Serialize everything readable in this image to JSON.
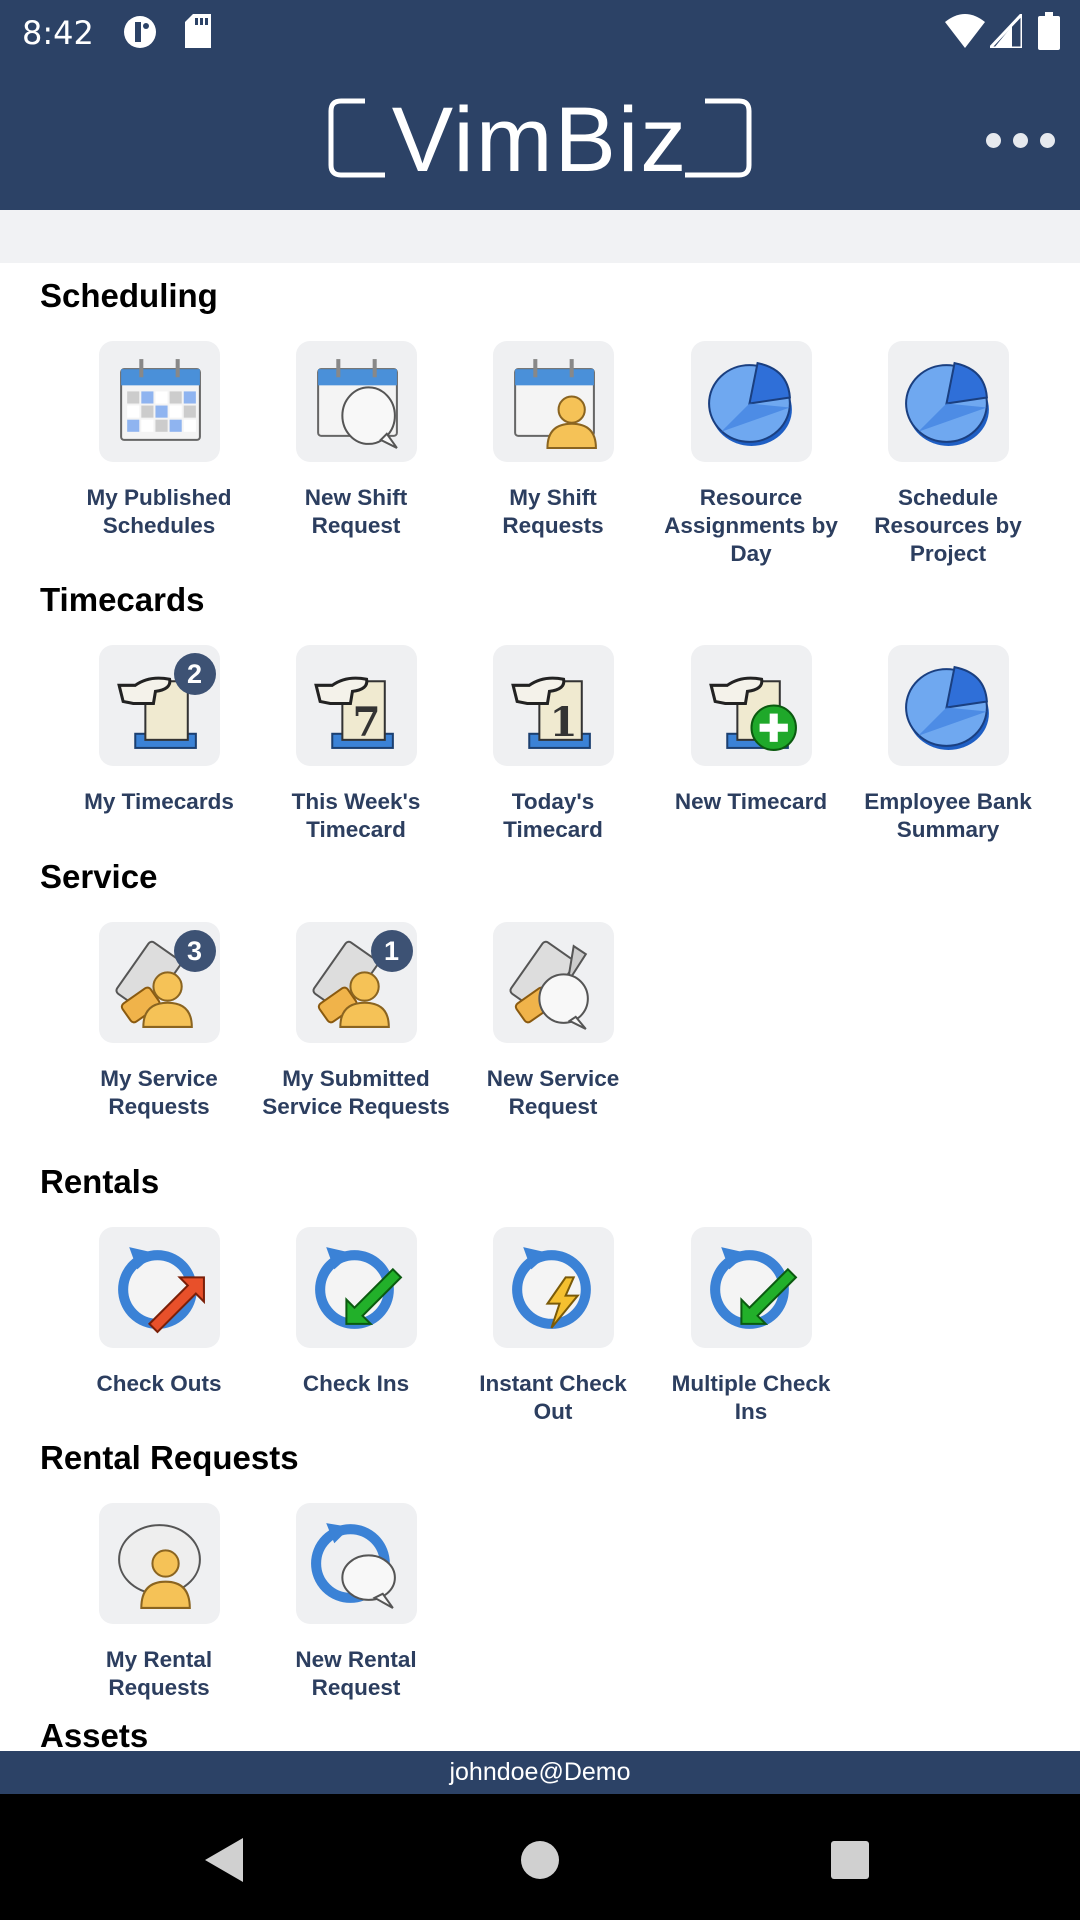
{
  "status_bar": {
    "time": "8:42",
    "icons": [
      "data-saver-icon",
      "sd-card-icon",
      "wifi-icon",
      "signal-icon",
      "battery-icon"
    ]
  },
  "app_bar": {
    "logo_text": "VimBiz",
    "menu_icon": "more-horizontal-icon"
  },
  "colors": {
    "brand": "#2c4266",
    "label": "#2c3e5f",
    "badge": "#3d5274",
    "tile": "#eff0f2"
  },
  "sections": [
    {
      "title": "Scheduling",
      "items": [
        {
          "label": "My Published Schedules",
          "icon": "calendar-grid"
        },
        {
          "label": "New Shift Request",
          "icon": "calendar-speech"
        },
        {
          "label": "My Shift Requests",
          "icon": "calendar-person"
        },
        {
          "label": "Resource Assignments by Day",
          "icon": "pie-chart"
        },
        {
          "label": "Schedule Resources by Project",
          "icon": "pie-chart"
        }
      ]
    },
    {
      "title": "Timecards",
      "items": [
        {
          "label": "My Timecards",
          "icon": "timecard",
          "badge": "2"
        },
        {
          "label": "This Week's Timecard",
          "icon": "timecard-7"
        },
        {
          "label": "Today's Timecard",
          "icon": "timecard-1"
        },
        {
          "label": "New Timecard",
          "icon": "timecard-plus"
        },
        {
          "label": "Employee Bank Summary",
          "icon": "pie-chart"
        }
      ]
    },
    {
      "title": "Service",
      "items": [
        {
          "label": "My Service Requests",
          "icon": "service-person",
          "badge": "3"
        },
        {
          "label": "My Submitted Service Requests",
          "icon": "service-person",
          "badge": "1"
        },
        {
          "label": "New Service Request",
          "icon": "service-speech"
        }
      ]
    },
    {
      "title": "Rentals",
      "items": [
        {
          "label": "Check Outs",
          "icon": "rental-checkout"
        },
        {
          "label": "Check Ins",
          "icon": "rental-checkin"
        },
        {
          "label": "Instant Check Out",
          "icon": "rental-instant"
        },
        {
          "label": "Multiple Check Ins",
          "icon": "rental-checkin"
        }
      ]
    },
    {
      "title": "Rental Requests",
      "items": [
        {
          "label": "My Rental Requests",
          "icon": "speech-person"
        },
        {
          "label": "New Rental Request",
          "icon": "rental-speech"
        }
      ]
    },
    {
      "title": "Assets",
      "items": []
    }
  ],
  "footer": {
    "user": "johndoe@Demo"
  },
  "nav_bar": {
    "buttons": [
      "back",
      "home",
      "recents"
    ]
  }
}
